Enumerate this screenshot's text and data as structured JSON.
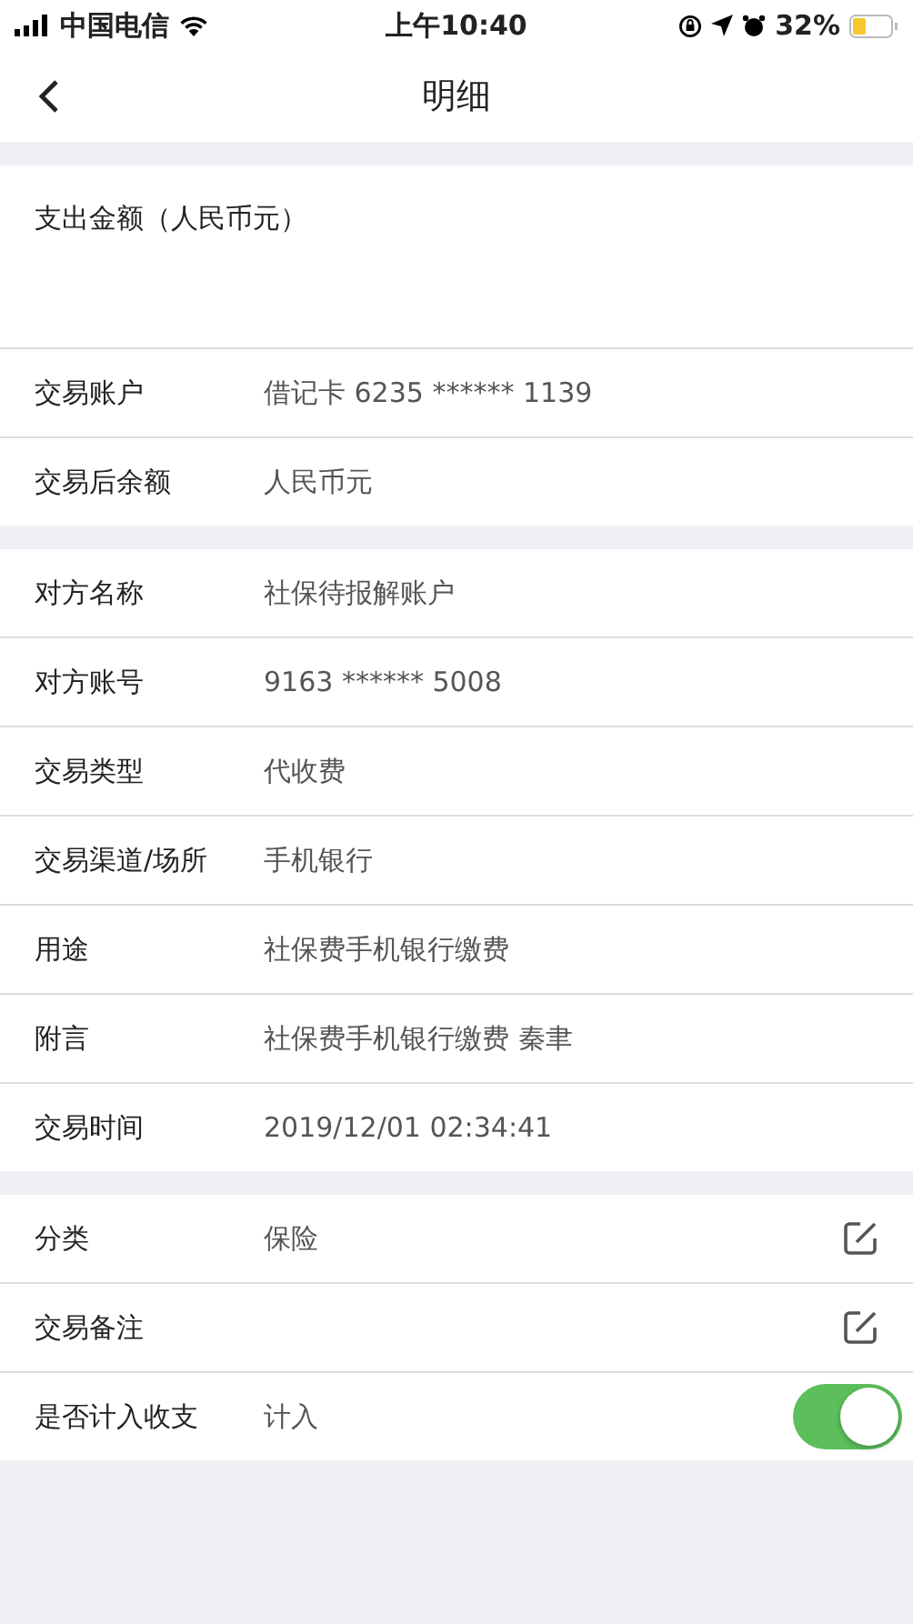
{
  "status_bar": {
    "carrier": "中国电信",
    "time": "上午10:40",
    "battery": "32%"
  },
  "nav": {
    "title": "明细"
  },
  "sections": [
    {
      "rows": [
        {
          "kind": "amount",
          "label": "支出金额（人民币元）"
        },
        {
          "kind": "text",
          "label": "交易账户",
          "value": "借记卡 6235 ****** 1139"
        },
        {
          "kind": "text",
          "label": "交易后余额",
          "value": "人民币元"
        }
      ]
    },
    {
      "rows": [
        {
          "kind": "text",
          "label": "对方名称",
          "value": "社保待报解账户"
        },
        {
          "kind": "text",
          "label": "对方账号",
          "value": "9163 ****** 5008"
        },
        {
          "kind": "text",
          "label": "交易类型",
          "value": "代收费"
        },
        {
          "kind": "text",
          "label": "交易渠道/场所",
          "value": "手机银行"
        },
        {
          "kind": "text",
          "label": "用途",
          "value": "社保费手机银行缴费"
        },
        {
          "kind": "text",
          "label": "附言",
          "value": "社保费手机银行缴费 秦聿"
        },
        {
          "kind": "text",
          "label": "交易时间",
          "value": "2019/12/01  02:34:41"
        }
      ]
    },
    {
      "rows": [
        {
          "kind": "edit",
          "label": "分类",
          "value": "保险"
        },
        {
          "kind": "edit",
          "label": "交易备注"
        },
        {
          "kind": "toggle",
          "label": "是否计入收支",
          "value": "计入",
          "on": true
        }
      ]
    }
  ]
}
